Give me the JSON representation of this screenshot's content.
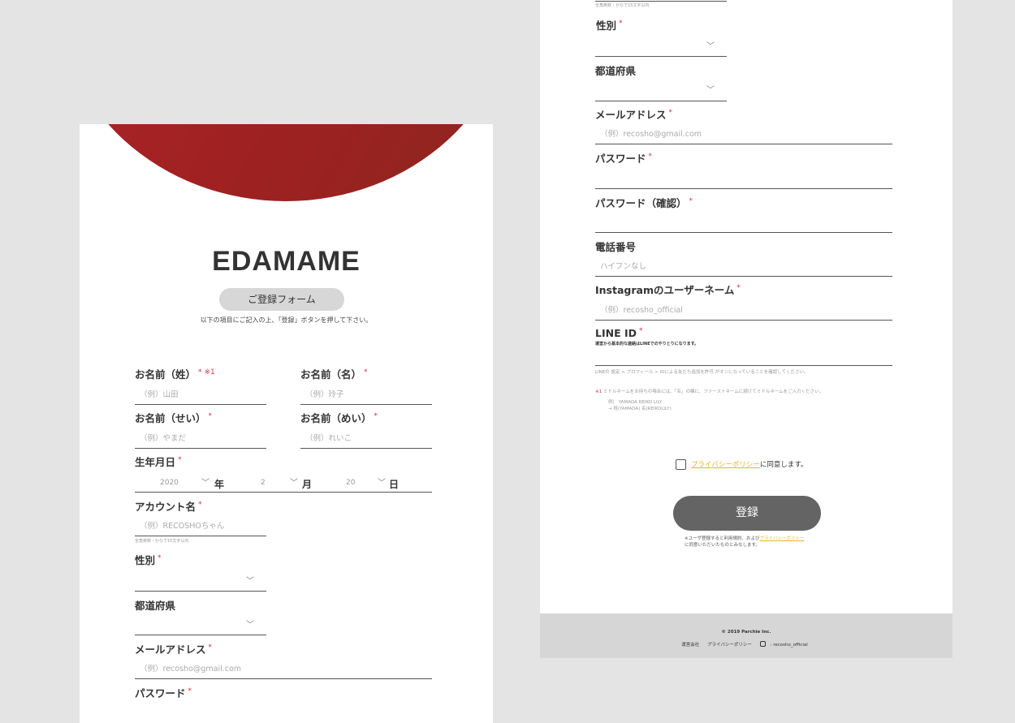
{
  "left": {
    "brand": "EDAMAME",
    "form_label": "ご登録フォーム",
    "intro": "以下の項目にご記入の上、「登録」ボタンを押して下さい。",
    "last_name": {
      "label": "お名前（姓）",
      "note": "※1",
      "placeholder": "（例）山田"
    },
    "first_name": {
      "label": "お名前（名）",
      "placeholder": "（例）玲子"
    },
    "last_kana": {
      "label": "お名前（せい）",
      "placeholder": "（例）やまだ"
    },
    "first_kana": {
      "label": "お名前（めい）",
      "placeholder": "（例）れいこ"
    },
    "birthday": {
      "label": "生年月日",
      "year": "2020",
      "year_unit": "年",
      "month": "2",
      "month_unit": "月",
      "day": "20",
      "day_unit": "日"
    },
    "account": {
      "label": "アカウント名",
      "placeholder": "（例）RECOSHOちゃん",
      "hint": "全角英数・かなで15文字以内"
    },
    "gender": {
      "label": "性別"
    },
    "prefecture": {
      "label": "都道府県"
    },
    "email": {
      "label": "メールアドレス",
      "placeholder": "（例）recosho@gmail.com"
    },
    "password": {
      "label": "パスワード"
    }
  },
  "right": {
    "top_hint": "全角英数・かなで15文字以内",
    "gender": {
      "label": "性別"
    },
    "prefecture": {
      "label": "都道府県"
    },
    "email": {
      "label": "メールアドレス",
      "placeholder": "（例）recosho@gmail.com"
    },
    "password": {
      "label": "パスワード"
    },
    "password_confirm": {
      "label": "パスワード（確認）"
    },
    "phone": {
      "label": "電話番号",
      "placeholder": "ハイフンなし"
    },
    "instagram": {
      "label": "Instagramのユーザーネーム",
      "placeholder": "（例）recosho_official"
    },
    "line": {
      "label": "LINE ID",
      "sub": "運営から基本的な連絡はLINEでのやりとりになります。",
      "hint": "LINEの 設定 > プロフィール > IDによる友だち追加を許可 がオンになっていることを確認してください。"
    },
    "note1_mark": "※1",
    "note1": "ミドルネームをお持ちの場合には、「名」の欄に、ファーストネームに続けてミドルネームをご入力ください。",
    "note1_ex1": "例） YAMADA REIKO LILY",
    "note1_ex2": "→ 姓(YAMADA) 名(REIKOLILY)",
    "privacy_link": "プライバシーポリシー",
    "privacy_agree": "に同意します。",
    "submit": "登録",
    "sub_note_1": "※ユーザ登録すると利用規約、および",
    "sub_note_link": "プライバシーポリシー",
    "sub_note_2": "に同意いただいたものとみなします。",
    "footer": {
      "copyright": "© 2019 Parchie Inc.",
      "company": "運営会社",
      "privacy": "プライバシーポリシー",
      "instagram": ": recosho_official"
    }
  },
  "colors": {
    "accent": "#a32224",
    "required": "#d3313c",
    "link": "#e7b325",
    "button": "#646464"
  }
}
